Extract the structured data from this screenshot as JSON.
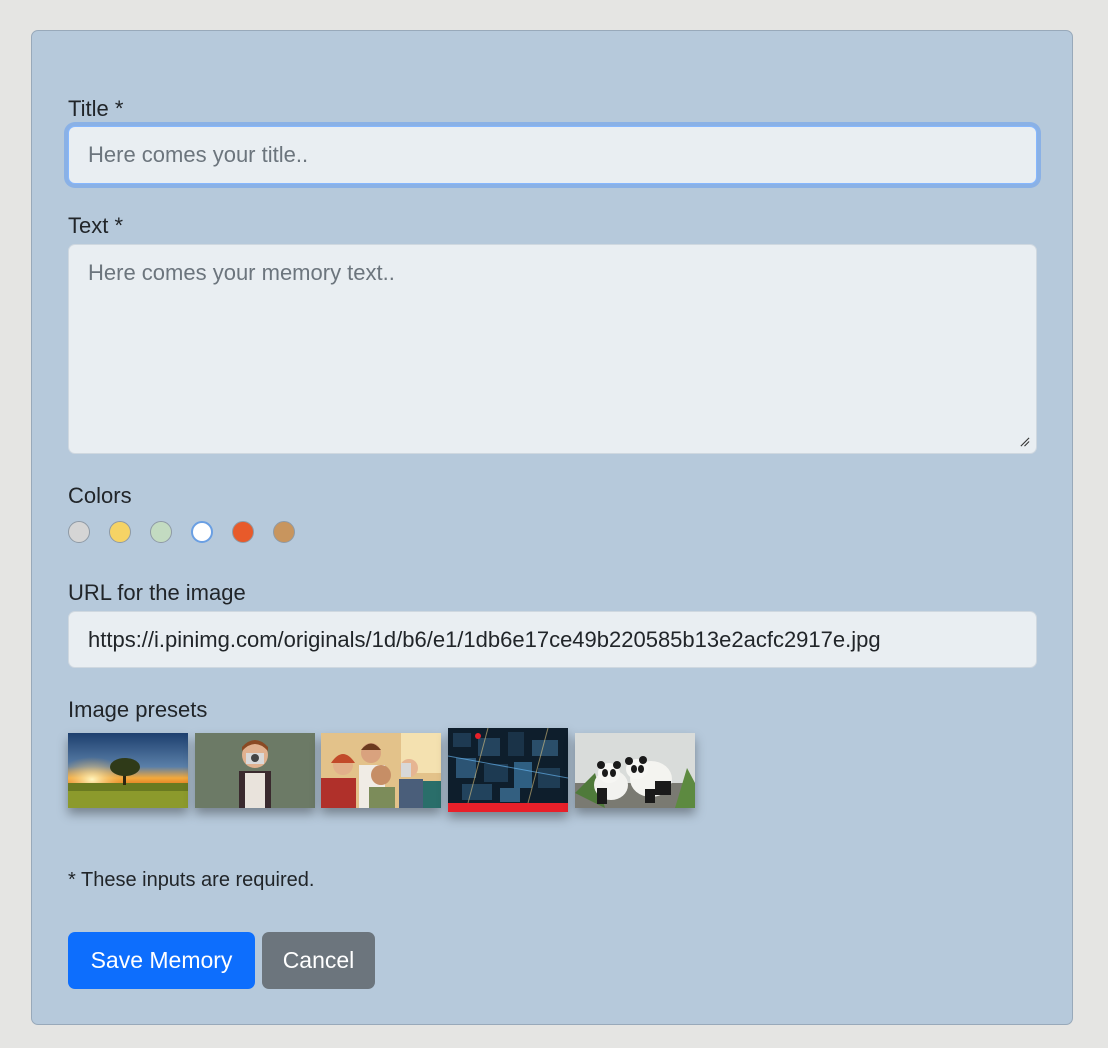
{
  "form": {
    "title_label": "Title *",
    "title_placeholder": "Here comes your title..",
    "title_value": "",
    "text_label": "Text *",
    "text_placeholder": "Here comes your memory text..",
    "text_value": "",
    "colors_label": "Colors",
    "colors": [
      {
        "name": "gray",
        "hex": "#d5d5d5",
        "selected": false
      },
      {
        "name": "yellow",
        "hex": "#f6d365",
        "selected": false
      },
      {
        "name": "green",
        "hex": "#c3dbc1",
        "selected": false
      },
      {
        "name": "white",
        "hex": "#ffffff",
        "selected": true
      },
      {
        "name": "orange",
        "hex": "#e85a2a",
        "selected": false
      },
      {
        "name": "brown",
        "hex": "#c8955e",
        "selected": false
      }
    ],
    "url_label": "URL for the image",
    "url_value": "https://i.pinimg.com/originals/1d/b6/e1/1db6e17ce49b220585b13e2acfc2917e.jpg",
    "presets_label": "Image presets",
    "presets": [
      {
        "name": "tree-sunset",
        "selected": false
      },
      {
        "name": "child-camera",
        "selected": false
      },
      {
        "name": "friends-selfie",
        "selected": false
      },
      {
        "name": "city-aerial",
        "selected": true
      },
      {
        "name": "pandas",
        "selected": false
      }
    ],
    "required_note": "* These inputs are required.",
    "save_label": "Save Memory",
    "cancel_label": "Cancel"
  },
  "theme": {
    "card_bg": "#b6c9db",
    "page_bg": "#e5e5e3",
    "primary": "#0d6efd",
    "secondary": "#6c757d",
    "active_preset_underline": "#e8202a"
  }
}
